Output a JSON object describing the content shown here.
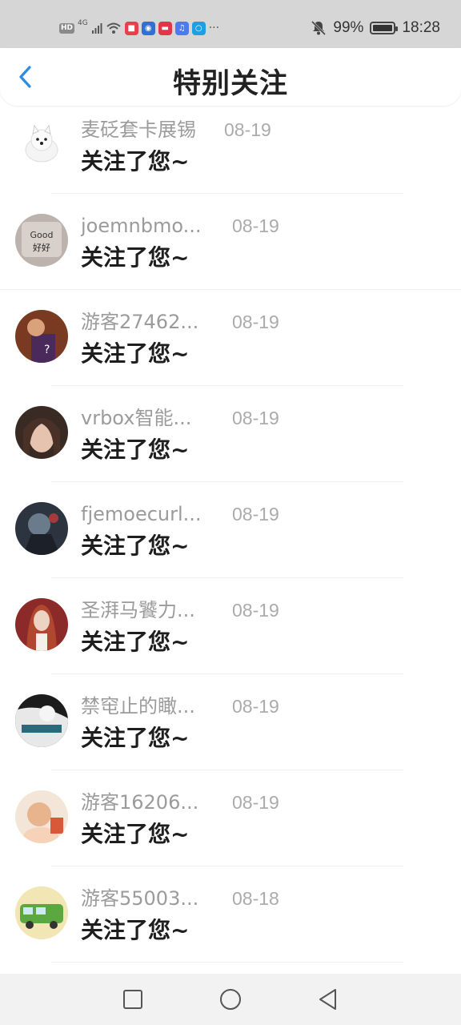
{
  "status_bar": {
    "hd": "HD",
    "network": "4G",
    "more": "···",
    "battery_percent": "99%",
    "battery_level": 0.99,
    "time": "18:28",
    "app_icons": [
      {
        "name": "red-app-icon",
        "color": "#e8404a"
      },
      {
        "name": "bulb-app-icon",
        "color": "#2f6fd6"
      },
      {
        "name": "wallet-app-icon",
        "color": "#e0364a"
      },
      {
        "name": "music-app-icon",
        "color": "#4a7cf0"
      },
      {
        "name": "search-app-icon",
        "color": "#1f9ee8"
      }
    ]
  },
  "header": {
    "title": "特别关注",
    "accent": "#2d8ce0"
  },
  "notifications": [
    {
      "name": "麦砭套卡展锡",
      "date": "08-19",
      "message": "关注了您~"
    },
    {
      "name": "joemnbmo...",
      "date": "08-19",
      "message": "关注了您~"
    },
    {
      "name": "游客27462...",
      "date": "08-19",
      "message": "关注了您~"
    },
    {
      "name": "vrbox智能...",
      "date": "08-19",
      "message": "关注了您~"
    },
    {
      "name": "fjemoecurl...",
      "date": "08-19",
      "message": "关注了您~"
    },
    {
      "name": "圣湃马饕力...",
      "date": "08-19",
      "message": "关注了您~"
    },
    {
      "name": "禁窀止的瞰...",
      "date": "08-19",
      "message": "关注了您~"
    },
    {
      "name": "游客16206...",
      "date": "08-19",
      "message": "关注了您~"
    },
    {
      "name": "游客55003...",
      "date": "08-18",
      "message": "关注了您~"
    }
  ]
}
